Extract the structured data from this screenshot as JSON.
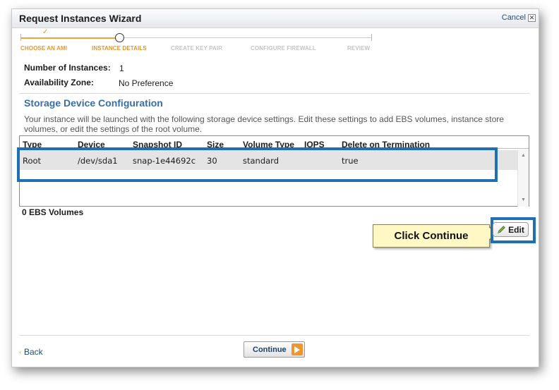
{
  "wizard": {
    "title": "Request Instances Wizard",
    "cancel_label": "Cancel",
    "cancel_icon": "close-icon"
  },
  "steps": [
    {
      "label": "CHOOSE AN AMI",
      "state": "complete"
    },
    {
      "label": "INSTANCE DETAILS",
      "state": "current"
    },
    {
      "label": "CREATE KEY PAIR",
      "state": "pending"
    },
    {
      "label": "CONFIGURE FIREWALL",
      "state": "pending"
    },
    {
      "label": "REVIEW",
      "state": "pending"
    }
  ],
  "details": {
    "instances_label": "Number of Instances:",
    "instances_value": "1",
    "zone_label": "Availability Zone:",
    "zone_value": "No Preference"
  },
  "storage": {
    "title": "Storage Device Configuration",
    "description": "Your instance will be launched with the following storage device settings. Edit these settings to add EBS volumes, instance store volumes, or edit the settings of the root volume.",
    "columns": [
      "Type",
      "Device",
      "Snapshot ID",
      "Size",
      "Volume Type",
      "IOPS",
      "Delete on Termination"
    ],
    "rows": [
      [
        "Root",
        "/dev/sda1",
        "snap-1e44692c",
        "30",
        "standard",
        "",
        "true"
      ]
    ],
    "ebs_count": "0 EBS Volumes",
    "edit_label": "Edit"
  },
  "callout": {
    "text": "Click Continue"
  },
  "footer": {
    "back_label": "Back",
    "continue_label": "Continue"
  },
  "colors": {
    "accent_orange": "#e8942d",
    "highlight_blue": "#1f6fb5",
    "section_title": "#3a6ea5",
    "callout_bg": "#fff7c4"
  }
}
